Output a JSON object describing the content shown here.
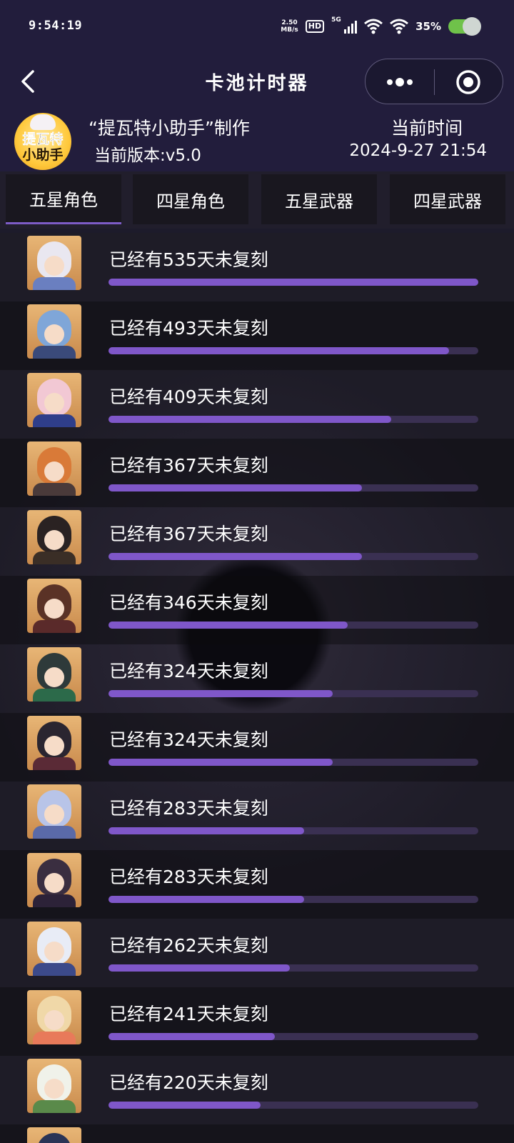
{
  "status": {
    "time": "9:54:19",
    "net_speed": "2.50",
    "net_unit": "MB/s",
    "hd": "HD",
    "signal": "5G",
    "battery": "35%"
  },
  "nav": {
    "title": "卡池计时器"
  },
  "header": {
    "logo_line1": "提瓦特",
    "logo_line2": "小助手",
    "maker": "“提瓦特小助手”制作",
    "version": "当前版本:v5.0",
    "current_time_label": "当前时间",
    "current_time": "2024-9-27 21:54"
  },
  "tabs": [
    "五星角色",
    "四星角色",
    "五星武器",
    "四星武器"
  ],
  "active_tab": 0,
  "colors": {
    "accent": "#7f57c9",
    "track": "#3a3052",
    "nav_bg": "#221d3c"
  },
  "max_days": 535,
  "items": [
    {
      "label": "已经有535天未复刻",
      "days": 535,
      "hair": "#e9e7f0",
      "outfit": "#6a7fc0"
    },
    {
      "label": "已经有493天未复刻",
      "days": 493,
      "hair": "#7fa6d8",
      "outfit": "#3a4a7a"
    },
    {
      "label": "已经有409天未复刻",
      "days": 409,
      "hair": "#f2c8d4",
      "outfit": "#2f3e8a"
    },
    {
      "label": "已经有367天未复刻",
      "days": 367,
      "hair": "#d97a38",
      "outfit": "#4a3a3a"
    },
    {
      "label": "已经有367天未复刻",
      "days": 367,
      "hair": "#2a2222",
      "outfit": "#3a2e26"
    },
    {
      "label": "已经有346天未复刻",
      "days": 346,
      "hair": "#5a3226",
      "outfit": "#5a2a2a"
    },
    {
      "label": "已经有324天未复刻",
      "days": 324,
      "hair": "#2e3a3a",
      "outfit": "#2c6a4a"
    },
    {
      "label": "已经有324天未复刻",
      "days": 324,
      "hair": "#2a2530",
      "outfit": "#5a2a36"
    },
    {
      "label": "已经有283天未复刻",
      "days": 283,
      "hair": "#b8c4e8",
      "outfit": "#5a6aa8"
    },
    {
      "label": "已经有283天未复刻",
      "days": 283,
      "hair": "#3a2e40",
      "outfit": "#2c2238"
    },
    {
      "label": "已经有262天未复刻",
      "days": 262,
      "hair": "#e8ecf6",
      "outfit": "#3c4a8a"
    },
    {
      "label": "已经有241天未复刻",
      "days": 241,
      "hair": "#f0d8a8",
      "outfit": "#e87a5a"
    },
    {
      "label": "已经有220天未复刻",
      "days": 220,
      "hair": "#f0f2ea",
      "outfit": "#5a8a4a"
    },
    {
      "label": "",
      "days": 0,
      "hair": "#2a3456",
      "outfit": "#3a4466"
    }
  ]
}
